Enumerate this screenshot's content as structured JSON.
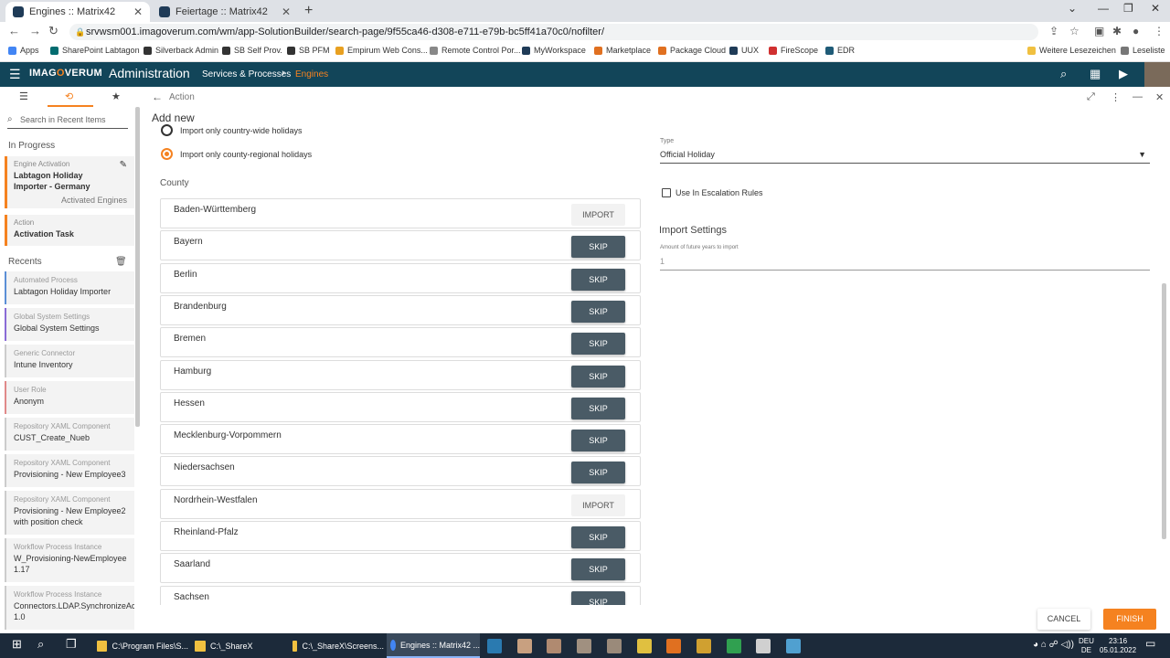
{
  "browser": {
    "tabs": [
      {
        "title": "Engines :: Matrix42"
      },
      {
        "title": "Feiertage :: Matrix42"
      }
    ],
    "url": "srvwsm001.imagoverum.com/wm/app-SolutionBuilder/search-page/9f55ca46-d308-e711-e79b-bc5ff41a70c0/nofilter/",
    "bookmarks": [
      "Apps",
      "SharePoint Labtagon",
      "Silverback Admin",
      "SB Self Prov.",
      "SB PFM",
      "Empirum Web Cons...",
      "Remote Control Por...",
      "MyWorkspace",
      "Marketplace",
      "Package Cloud",
      "UUX",
      "FireScope",
      "EDR",
      "Weitere Lesezeichen",
      "Leseliste"
    ]
  },
  "header": {
    "logo_pre": "IMAG",
    "logo_o": "O",
    "logo_post": "VERUM",
    "title": "Administration",
    "breadcrumb": [
      "Services & Processes",
      "Engines"
    ]
  },
  "sidebar": {
    "search_placeholder": "Search in Recent Items",
    "in_progress_label": "In Progress",
    "in_progress": [
      {
        "category": "Engine Activation",
        "title": "Labtagon Holiday Importer - Germany",
        "sub": "Activated Engines"
      },
      {
        "category": "Action",
        "title": "Activation Task"
      }
    ],
    "recents_label": "Recents",
    "recents": [
      {
        "category": "Automated Process",
        "title": "Labtagon Holiday Importer",
        "color": "#5b8fd6"
      },
      {
        "category": "Global System Settings",
        "title": "Global System Settings",
        "color": "#8a6bd6"
      },
      {
        "category": "Generic Connector",
        "title": "Intune Inventory",
        "color": "#cccccc"
      },
      {
        "category": "User Role",
        "title": "Anonym",
        "color": "#e08a8a"
      },
      {
        "category": "Repository XAML Component",
        "title": "CUST_Create_Nueb",
        "color": "#cccccc"
      },
      {
        "category": "Repository XAML Component",
        "title": "Provisioning - New Employee3",
        "color": "#cccccc"
      },
      {
        "category": "Repository XAML Component",
        "title": "Provisioning - New Employee2",
        "title2": "with position check",
        "color": "#cccccc"
      },
      {
        "category": "Workflow Process Instance",
        "title": "W_Provisioning-NewEmployee",
        "title2": "1.17",
        "color": "#cccccc"
      },
      {
        "category": "Workflow Process Instance",
        "title": "Connectors.LDAP.SynchronizeAcc",
        "title2": "1.0",
        "color": "#cccccc"
      }
    ]
  },
  "main": {
    "header_title": "Action",
    "add_new": "Add new",
    "radio_country": "Import only country-wide holidays",
    "radio_county": "Import only county-regional holidays",
    "county_label": "County",
    "counties": [
      {
        "name": "Baden-Württemberg",
        "action": "IMPORT"
      },
      {
        "name": "Bayern",
        "action": "SKIP"
      },
      {
        "name": "Berlin",
        "action": "SKIP"
      },
      {
        "name": "Brandenburg",
        "action": "SKIP"
      },
      {
        "name": "Bremen",
        "action": "SKIP"
      },
      {
        "name": "Hamburg",
        "action": "SKIP"
      },
      {
        "name": "Hessen",
        "action": "SKIP"
      },
      {
        "name": "Mecklenburg-Vorpommern",
        "action": "SKIP"
      },
      {
        "name": "Niedersachsen",
        "action": "SKIP"
      },
      {
        "name": "Nordrhein-Westfalen",
        "action": "IMPORT"
      },
      {
        "name": "Rheinland-Pfalz",
        "action": "SKIP"
      },
      {
        "name": "Saarland",
        "action": "SKIP"
      },
      {
        "name": "Sachsen",
        "action": "SKIP"
      }
    ],
    "type_label": "Type",
    "type_value": "Official Holiday",
    "escalation_label": "Use In Escalation Rules",
    "import_settings": "Import Settings",
    "years_label": "Amount of future years to import",
    "years_value": "1",
    "cancel": "CANCEL",
    "finish": "FINISH"
  },
  "taskbar": {
    "apps": [
      {
        "label": "C:\\Program Files\\S..."
      },
      {
        "label": "C:\\_ShareX"
      },
      {
        "label": "C:\\_ShareX\\Screens..."
      },
      {
        "label": "Engines :: Matrix42 ..."
      }
    ],
    "lang1": "DEU",
    "lang2": "DE",
    "time": "23:16",
    "date": "05.01.2022"
  },
  "colors": {
    "accent": "#f58220",
    "header": "#124559",
    "skip": "#4a5b66"
  }
}
